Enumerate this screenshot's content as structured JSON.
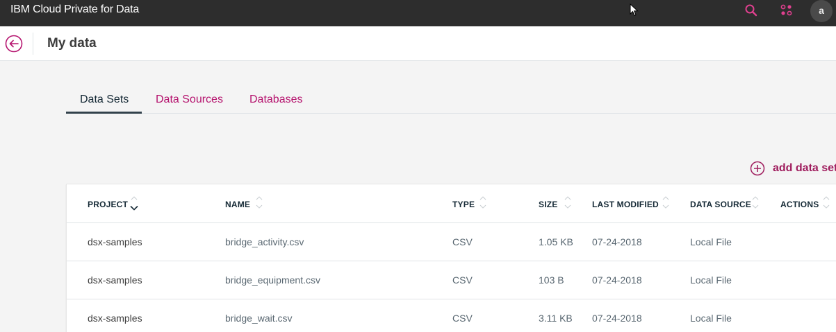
{
  "app": {
    "title": "IBM Cloud Private for Data",
    "avatar_initial": "a"
  },
  "icons": {
    "search": "search-icon",
    "apps": "apps-icon",
    "back": "back-arrow-icon",
    "add": "add-circle-icon"
  },
  "colors": {
    "accent": "#b5136e",
    "topbar": "#2d2d2d"
  },
  "page": {
    "title": "My data"
  },
  "tabs": [
    {
      "label": "Data Sets",
      "active": true
    },
    {
      "label": "Data Sources",
      "active": false
    },
    {
      "label": "Databases",
      "active": false
    }
  ],
  "actions": {
    "add_label": "add data set"
  },
  "table": {
    "columns": [
      "PROJECT",
      "NAME",
      "TYPE",
      "SIZE",
      "LAST MODIFIED",
      "DATA SOURCE",
      "ACTIONS"
    ],
    "rows": [
      {
        "project": "dsx-samples",
        "name": "bridge_activity.csv",
        "type": "CSV",
        "size": "1.05 KB",
        "modified": "07-24-2018",
        "source": "Local File"
      },
      {
        "project": "dsx-samples",
        "name": "bridge_equipment.csv",
        "type": "CSV",
        "size": "103 B",
        "modified": "07-24-2018",
        "source": "Local File"
      },
      {
        "project": "dsx-samples",
        "name": "bridge_wait.csv",
        "type": "CSV",
        "size": "3.11 KB",
        "modified": "07-24-2018",
        "source": "Local File"
      }
    ]
  }
}
